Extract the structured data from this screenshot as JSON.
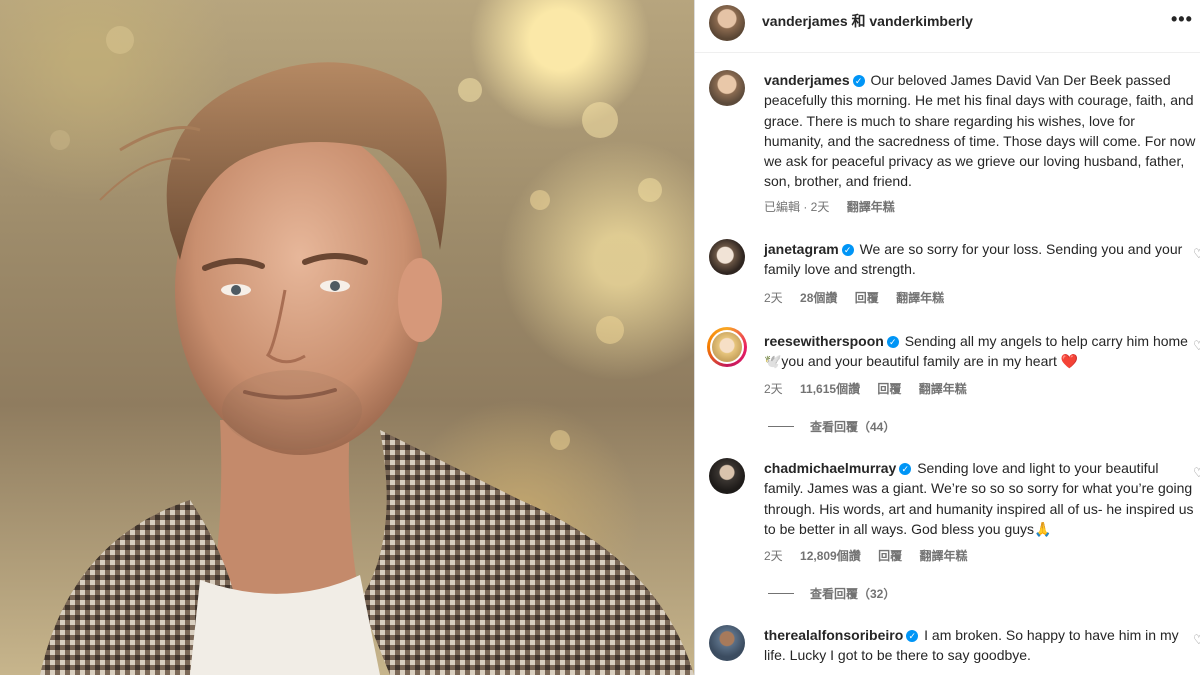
{
  "header": {
    "title": "vanderjames 和 vanderkimberly",
    "more_label": "•••"
  },
  "post": {
    "username": "vanderjames",
    "text": "Our beloved James David Van Der Beek passed peacefully this morning. He met his final days with courage, faith, and grace. There is much to share regarding his wishes, love for humanity, and the sacredness of time. Those days will come. For now we ask for peaceful privacy as we grieve our loving husband, father, son, brother, and friend.",
    "meta_edited": "已編輯 · 2天",
    "meta_translate": "翻譯年糕"
  },
  "comments": [
    {
      "username": "janetagram",
      "text": "We are so sorry for your loss. Sending you and your family love and strength.",
      "time": "2天",
      "likes": "28個讚",
      "reply": "回覆",
      "translate": "翻譯年糕"
    },
    {
      "username": "reesewitherspoon",
      "text_before": "Sending all my angels to help carry him home 🕊️you and your beautiful family are in my heart ",
      "emoji": "❤️",
      "time": "2天",
      "likes": "11,615個讚",
      "reply": "回覆",
      "translate": "翻譯年糕",
      "view_replies": "查看回覆（44）"
    },
    {
      "username": "chadmichaelmurray",
      "text": "Sending love and light to your beautiful family. James was a giant. We’re so so so sorry for what you’re going through. His words, art and humanity inspired all of us- he inspired us to be better in all ways. God bless you guys🙏",
      "time": "2天",
      "likes": "12,809個讚",
      "reply": "回覆",
      "translate": "翻譯年糕",
      "view_replies": "查看回覆（32）"
    },
    {
      "username": "therealalfonsoribeiro",
      "text": "I am broken. So happy to have him in my life. Lucky I got to be there to say goodbye."
    }
  ],
  "icons": {
    "verified": "verified-badge-icon",
    "heart": "heart-outline-icon",
    "more": "more-horizontal-icon"
  },
  "colors": {
    "verified_blue": "#0095f6",
    "meta_gray": "#737373",
    "text": "#262626"
  }
}
